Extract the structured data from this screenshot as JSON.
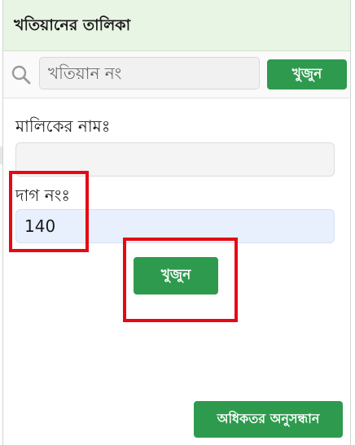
{
  "panel": {
    "title": "খতিয়ানের তালিকা"
  },
  "search": {
    "icon": "search-icon",
    "placeholder": "খতিয়ান নং",
    "button_label": "খুজুন"
  },
  "form": {
    "owner_label": "মালিকের নামঃ",
    "owner_value": "",
    "plot_label": "দাগ নংঃ",
    "plot_value": "140",
    "find_label": "খুজুন",
    "advanced_label": "অধিকতর অনুসন্ধান"
  },
  "colors": {
    "accent": "#2e9a4e",
    "header_bg": "#e9f5e4",
    "highlight": "#e50914",
    "autofill_bg": "#e8f0fe"
  }
}
